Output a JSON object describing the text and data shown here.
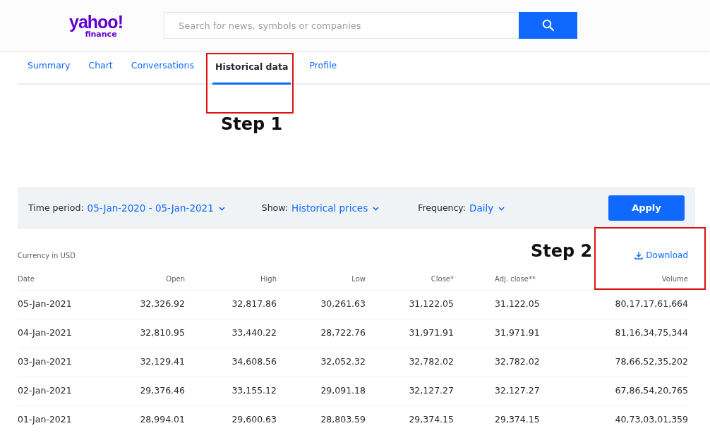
{
  "logo": {
    "brand": "yahoo!",
    "product": "finance"
  },
  "search": {
    "placeholder": "Search for news, symbols or companies"
  },
  "tabs": [
    {
      "label": "Summary",
      "selected": false
    },
    {
      "label": "Chart",
      "selected": false
    },
    {
      "label": "Conversations",
      "selected": false
    },
    {
      "label": "Historical data",
      "selected": true
    },
    {
      "label": "Profile",
      "selected": false
    }
  ],
  "filters": [
    {
      "label": "Time period:",
      "value": "05-Jan-2020 - 05-Jan-2021"
    },
    {
      "label": "Show:",
      "value": "Historical prices"
    },
    {
      "label": "Frequency:",
      "value": "Daily"
    }
  ],
  "apply_button": "Apply",
  "currency_note": "Currency in USD",
  "download_link": "Download",
  "table": {
    "columns": [
      "Date",
      "Open",
      "High",
      "Low",
      "Close*",
      "Adj. close**",
      "Volume"
    ],
    "rows": [
      [
        "05-Jan-2021",
        "32,326.92",
        "32,817.86",
        "30,261.63",
        "31,122.05",
        "31,122.05",
        "80,17,17,61,664"
      ],
      [
        "04-Jan-2021",
        "32,810.95",
        "33,440.22",
        "28,722.76",
        "31,971.91",
        "31,971.91",
        "81,16,34,75,344"
      ],
      [
        "03-Jan-2021",
        "32,129.41",
        "34,608.56",
        "32,052.32",
        "32,782.02",
        "32,782.02",
        "78,66,52,35,202"
      ],
      [
        "02-Jan-2021",
        "29,376.46",
        "33,155.12",
        "29,091.18",
        "32,127.27",
        "32,127.27",
        "67,86,54,20,765"
      ],
      [
        "01-Jan-2021",
        "28,994.01",
        "29,600.63",
        "28,803.59",
        "29,374.15",
        "29,374.15",
        "40,73,03,01,359"
      ]
    ]
  },
  "annotations": [
    {
      "label": "Step 1"
    },
    {
      "label": "Step 2"
    }
  ]
}
